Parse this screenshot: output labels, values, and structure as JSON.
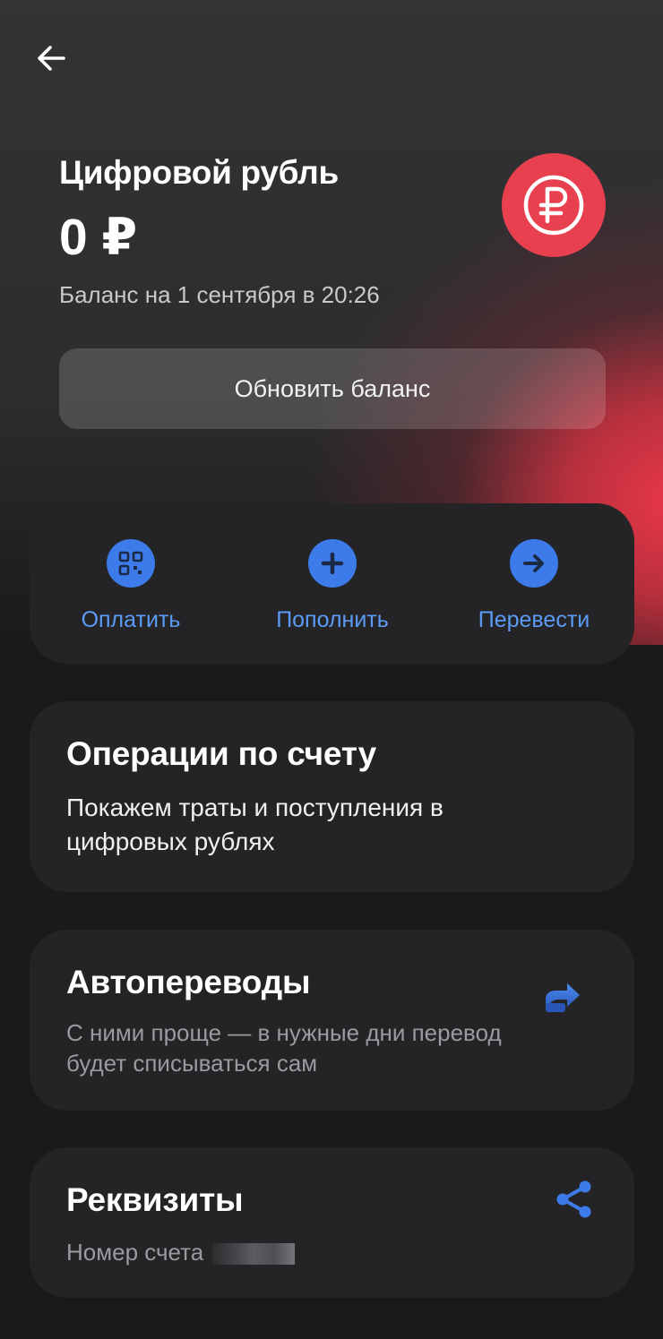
{
  "account": {
    "title": "Цифровой рубль",
    "balance": "0 ₽",
    "balance_date": "Баланс на 1 сентября в 20:26",
    "refresh_label": "Обновить баланс"
  },
  "actions": [
    {
      "label": "Оплатить",
      "icon": "qr-code-icon"
    },
    {
      "label": "Пополнить",
      "icon": "plus-icon"
    },
    {
      "label": "Перевести",
      "icon": "arrow-right-icon"
    }
  ],
  "operations": {
    "title": "Операции по счету",
    "text": "Покажем траты и поступления в цифровых рублях"
  },
  "autotransfers": {
    "title": "Автопереводы",
    "text": "С ними проще — в нужные дни перевод будет списываться сам",
    "icon": "share-arrow-icon"
  },
  "requisites": {
    "title": "Реквизиты",
    "account_label": "Номер счета",
    "icon": "share-icon"
  },
  "colors": {
    "accent_red": "#e8404f",
    "accent_blue": "#3c7be9",
    "link_blue": "#5b9bf5",
    "card_bg": "#242426",
    "page_bg": "#1a1a1c"
  }
}
